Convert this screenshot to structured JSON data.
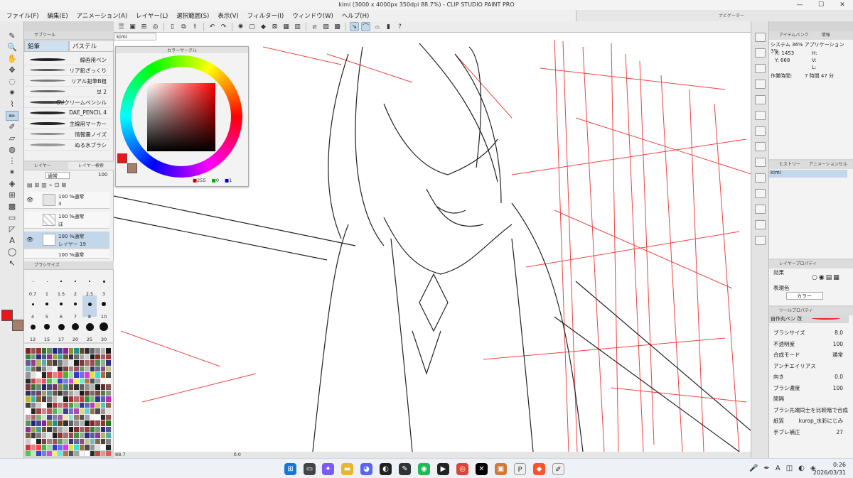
{
  "window": {
    "title": "kimi (3000 x 4000px 350dpi 88.7%)  - CLIP STUDIO PAINT PRO",
    "min": "—",
    "max": "☐",
    "close": "✕"
  },
  "menu": [
    "ファイル(F)",
    "編集(E)",
    "アニメーション(A)",
    "レイヤー(L)",
    "選択範囲(S)",
    "表示(V)",
    "フィルター(I)",
    "ウィンドウ(W)",
    "ヘルプ(H)"
  ],
  "navigator": {
    "label": "ナビゲーター"
  },
  "document_tab": "kimi",
  "subtool": {
    "header": "サブツール",
    "tabs": [
      "鉛筆",
      "パステル"
    ],
    "brushes": [
      "線画用ペン",
      "リア鉛ざっくり",
      "リアル鉛筆B粗",
      "보 2",
      "GUクリームペンシル",
      "DAE_PENCIL 4",
      "主線用マーカー",
      "情報量ノイズ",
      "ぬる水ブラシ"
    ]
  },
  "layers": {
    "tabs": [
      "レイヤー",
      "レイヤー検索"
    ],
    "blend": "通常",
    "opacity": "100",
    "rows": [
      {
        "line1": "100 %通常",
        "line2": "3"
      },
      {
        "line1": "100 %通常",
        "line2": "ぼ"
      },
      {
        "line1": "100 %通常",
        "line2": "レイヤー 19"
      },
      {
        "line1": "100 %通常",
        "line2": ""
      }
    ]
  },
  "brush_size": {
    "header": "ブラシサイズ",
    "values": [
      "0.7",
      "1",
      "1.5",
      "2",
      "2.5",
      "3",
      "4",
      "5",
      "6",
      "7",
      "8",
      "10",
      "12",
      "15",
      "17",
      "20",
      "25",
      "30"
    ],
    "selected": "8"
  },
  "color_circle": {
    "header": "カラーサークル",
    "r": "255",
    "g": "0",
    "b": "1"
  },
  "canvas_status": {
    "zoom": "88.7",
    "rotate": "0.0"
  },
  "info": {
    "tabs": [
      "アイテムバンク",
      "情報"
    ],
    "system": "システム 36%  アプリケーション 3%",
    "x": "X: 1453",
    "y": "Y: 668",
    "h": "H:",
    "v": "V:",
    "l": "L:",
    "worktime_label": "作業時間:",
    "worktime": "7 時間 47 分"
  },
  "history": {
    "tabs": [
      "ヒストリー",
      "アニメーションセル"
    ],
    "item": "kimi"
  },
  "layer_property": {
    "header": "レイヤープロパティ",
    "effect_label": "効果",
    "expr_label": "表現色",
    "expr_value": "カラー"
  },
  "tool_property": {
    "header": "ツールプロパティ",
    "tool_name": "自作丸ペン 改",
    "rows": [
      {
        "label": "ブラシサイズ",
        "value": "8.0"
      },
      {
        "label": "不透明度",
        "value": "100"
      },
      {
        "label": "合成モード",
        "value": "通常"
      },
      {
        "label": "アンチエイリアス",
        "value": ""
      },
      {
        "label": "向き",
        "value": "0.0"
      },
      {
        "label": "ブラシ濃度",
        "value": "100"
      },
      {
        "label": "間隔",
        "value": ""
      },
      {
        "label": "ブラシ先端同士を比較暗で合成",
        "value": ""
      },
      {
        "label": "紙質",
        "value": "kurop_水彩にじみ"
      },
      {
        "label": "手ブレ補正",
        "value": "27"
      }
    ]
  },
  "taskbar": {
    "time": "0:26",
    "date": "2026/03/31",
    "lang": "A"
  },
  "colors": {
    "main": "#e8171a",
    "sub": "#a57f6b",
    "accent": "#c3d6ea"
  }
}
